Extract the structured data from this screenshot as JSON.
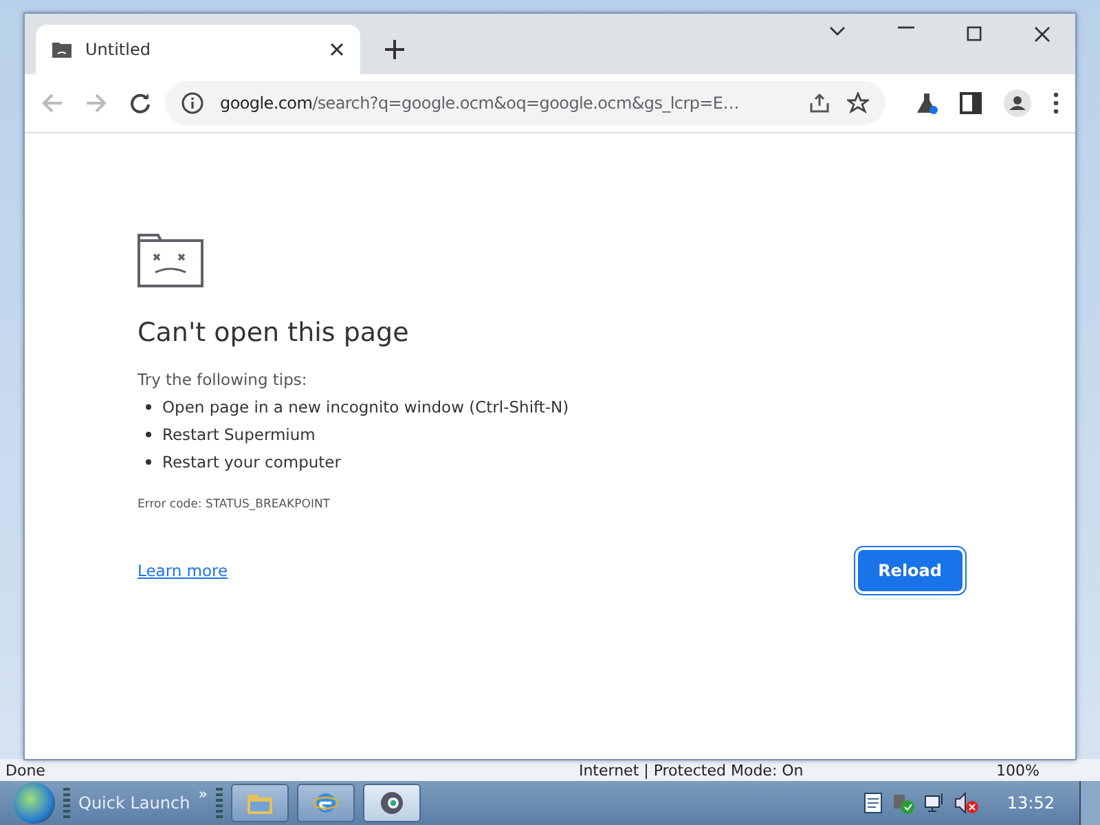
{
  "browser": {
    "tabs": [
      {
        "title": "Untitled",
        "selected": true
      }
    ],
    "address": {
      "host": "google.com",
      "path": "/search?q=google.ocm&oq=google.ocm&gs_lcrp=E…"
    }
  },
  "error_page": {
    "heading": "Can't open this page",
    "tips_intro": "Try the following tips:",
    "tips": [
      "Open page in a new incognito window (Ctrl-Shift-N)",
      "Restart Supermium",
      "Restart your computer"
    ],
    "error_code": "Error code: STATUS_BREAKPOINT",
    "learn_more": "Learn more",
    "reload": "Reload"
  },
  "background_window": {
    "status": "Done",
    "zone": "Internet | Protected Mode: On",
    "zoom": "100%"
  },
  "taskbar": {
    "quick_launch": "Quick Launch",
    "chevron": "»",
    "buttons": [
      {
        "kind": "folder",
        "selected": false
      },
      {
        "kind": "ie",
        "selected": false
      },
      {
        "kind": "browser",
        "selected": true
      }
    ],
    "clock": "13:52"
  }
}
